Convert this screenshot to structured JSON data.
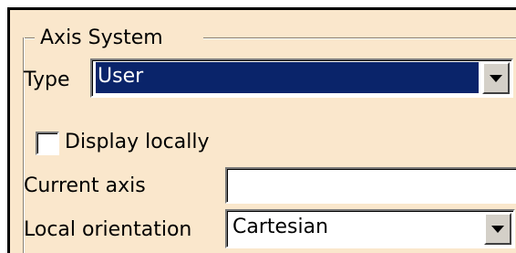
{
  "group": {
    "title": "Axis System"
  },
  "type_row": {
    "label": "Type",
    "value": "User",
    "dropdown_icon": "chevron-down-icon"
  },
  "display_locally": {
    "label": "Display locally",
    "checked": false
  },
  "current_axis": {
    "label": "Current axis",
    "value": ""
  },
  "local_orientation": {
    "label": "Local orientation",
    "value": "Cartesian",
    "dropdown_icon": "chevron-down-icon"
  },
  "colors": {
    "panel_background": "#fae7cc",
    "selection_background": "#0a246a",
    "selection_text": "#ffffff"
  }
}
